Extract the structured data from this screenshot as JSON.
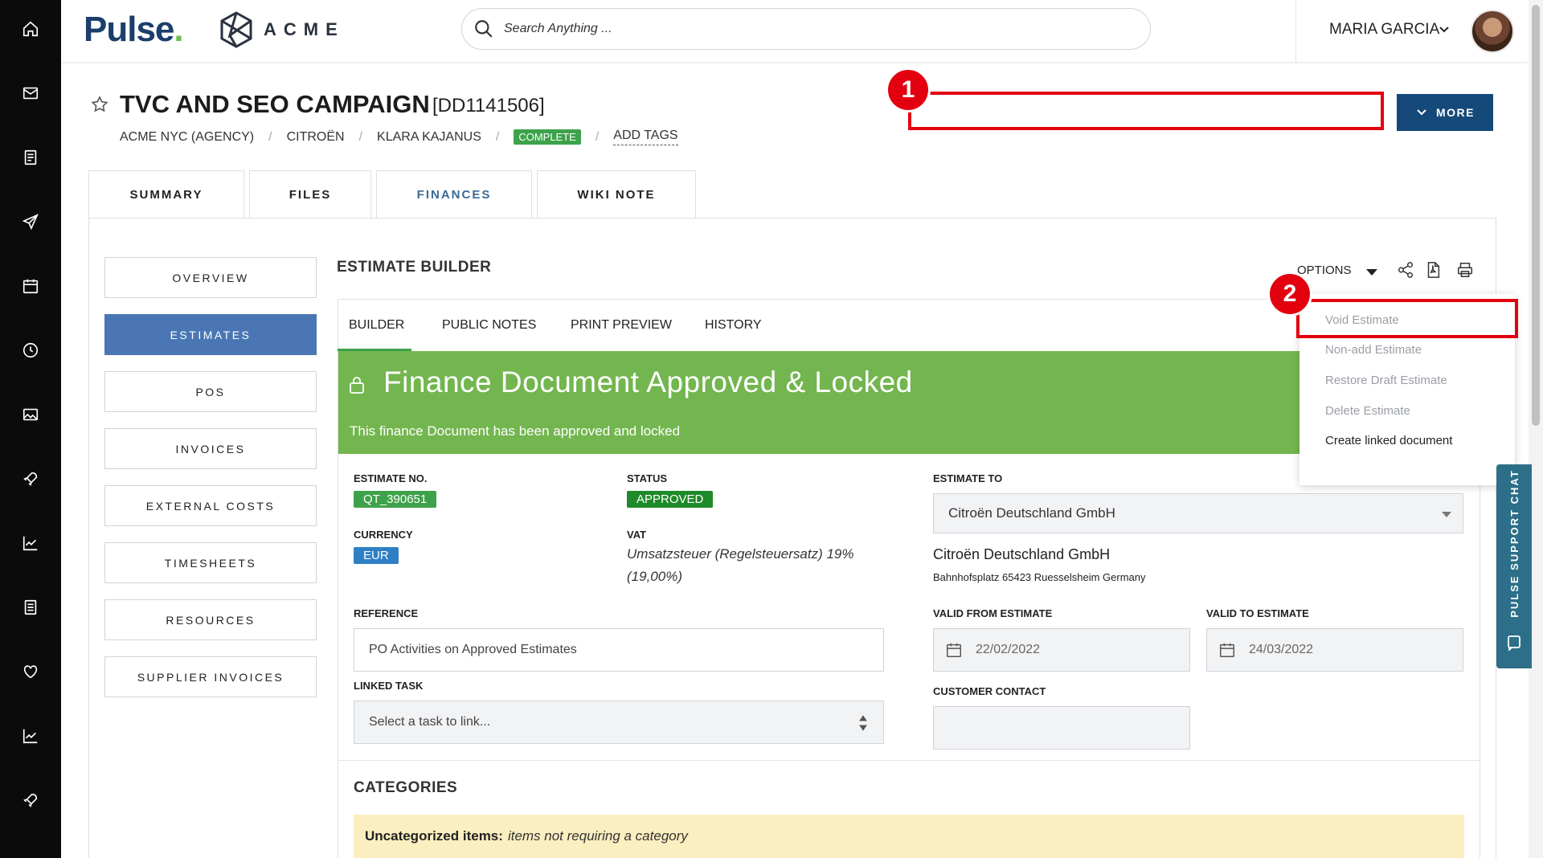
{
  "header": {
    "brand": "Pulse",
    "brand_dot": ".",
    "client_logo_text": "ACME",
    "search_placeholder": "Search Anything ...",
    "user_name": "MARIA GARCIA"
  },
  "project": {
    "title": "TVC AND SEO CAMPAIGN",
    "code": "[DD1141506]",
    "breadcrumb": [
      "ACME NYC (AGENCY)",
      "CITROËN",
      "KLARA KAJANUS"
    ],
    "status_badge": "COMPLETE",
    "add_tags": "ADD TAGS",
    "more_label": "MORE"
  },
  "annotations": {
    "marker_1": "1",
    "marker_2": "2"
  },
  "tabs": [
    {
      "label": "SUMMARY",
      "active": false
    },
    {
      "label": "FILES",
      "active": false
    },
    {
      "label": "FINANCES",
      "active": true
    },
    {
      "label": "WIKI NOTE",
      "active": false
    }
  ],
  "side_nav": [
    {
      "label": "OVERVIEW",
      "active": false
    },
    {
      "label": "ESTIMATES",
      "active": true
    },
    {
      "label": "POS",
      "active": false
    },
    {
      "label": "INVOICES",
      "active": false
    },
    {
      "label": "EXTERNAL COSTS",
      "active": false
    },
    {
      "label": "TIMESHEETS",
      "active": false
    },
    {
      "label": "RESOURCES",
      "active": false
    },
    {
      "label": "SUPPLIER INVOICES",
      "active": false
    }
  ],
  "estimate_builder": {
    "title": "ESTIMATE BUILDER",
    "options_label": "OPTIONS",
    "subtabs": [
      "BUILDER",
      "PUBLIC NOTES",
      "PRINT PREVIEW",
      "HISTORY"
    ],
    "locked_title": "Finance Document Approved & Locked",
    "locked_subtitle": "This finance Document has been approved and locked",
    "estimate_no_label": "ESTIMATE NO.",
    "estimate_no": "QT_390651",
    "status_label": "STATUS",
    "status": "APPROVED",
    "currency_label": "CURRENCY",
    "currency": "EUR",
    "vat_label": "VAT",
    "vat_line1": "Umsatzsteuer (Regelsteuersatz) 19%",
    "vat_line2": "(19,00%)",
    "reference_label": "REFERENCE",
    "reference_value": "PO Activities on Approved Estimates",
    "linked_task_label": "LINKED TASK",
    "linked_task_placeholder": "Select a task to link...",
    "estimate_to_label": "ESTIMATE TO",
    "estimate_to_value": "Citroën Deutschland GmbH",
    "customer_name": "Citroën Deutschland GmbH",
    "customer_address": "Bahnhofsplatz 65423 Ruesselsheim Germany",
    "valid_from_label": "VALID FROM ESTIMATE",
    "valid_from": "22/02/2022",
    "valid_to_label": "VALID TO ESTIMATE",
    "valid_to": "24/03/2022",
    "customer_contact_label": "CUSTOMER CONTACT",
    "categories_title": "CATEGORIES",
    "uncategorized_bold": "Uncategorized items:",
    "uncategorized_italic": "items not requiring a category"
  },
  "options_menu": [
    {
      "label": "Void Estimate",
      "enabled": false
    },
    {
      "label": "Non-add Estimate",
      "enabled": false
    },
    {
      "label": "Restore Draft Estimate",
      "enabled": false
    },
    {
      "label": "Delete Estimate",
      "enabled": false
    },
    {
      "label": "Create linked document",
      "enabled": true
    }
  ],
  "support_chat": "PULSE SUPPORT CHAT",
  "colors": {
    "brand_navy": "#1b3e6b",
    "primary_blue": "#14497a",
    "active_side": "#4a77b4",
    "success_green": "#3ea24a",
    "approved_green": "#1f8a2a",
    "locked_banner": "#73b64f",
    "currency_blue": "#2f7fc4",
    "annotation_red": "#e3000f",
    "chat_teal": "#2d6f88",
    "uncategorized_bg": "#fbeec0"
  }
}
